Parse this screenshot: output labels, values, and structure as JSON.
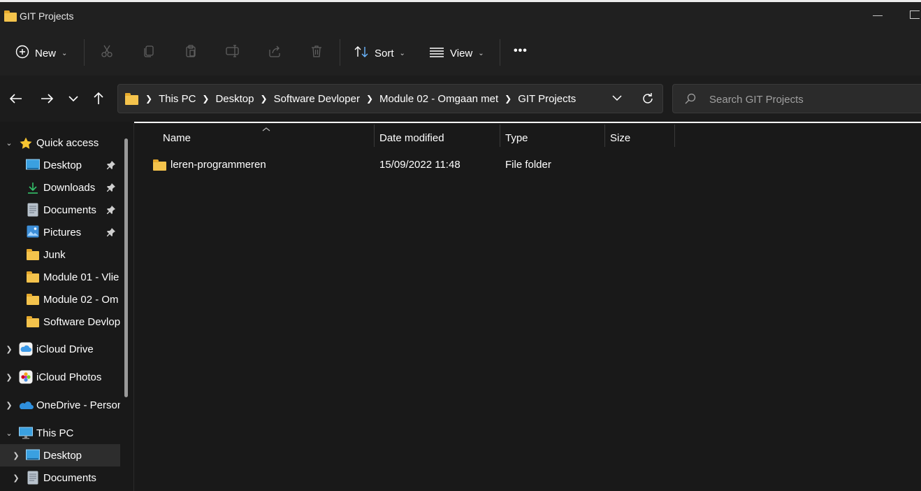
{
  "window": {
    "title": "GIT Projects"
  },
  "toolbar": {
    "new_label": "New",
    "sort_label": "Sort",
    "view_label": "View",
    "icons": [
      "cut-icon",
      "copy-icon",
      "paste-icon",
      "rename-icon",
      "share-icon",
      "delete-icon"
    ],
    "more_label": "•••"
  },
  "address": {
    "crumbs": [
      "This PC",
      "Desktop",
      "Software Devloper",
      "Module 02 - Omgaan met",
      "GIT Projects"
    ]
  },
  "search": {
    "placeholder": "Search GIT Projects"
  },
  "sidebar": {
    "quick_access": "Quick access",
    "items": [
      {
        "label": "Desktop",
        "icon": "desktop-icon",
        "pinned": true
      },
      {
        "label": "Downloads",
        "icon": "download-icon",
        "pinned": true
      },
      {
        "label": "Documents",
        "icon": "documents-icon",
        "pinned": true
      },
      {
        "label": "Pictures",
        "icon": "pictures-icon",
        "pinned": true
      },
      {
        "label": "Junk",
        "icon": "folder-icon",
        "pinned": false
      },
      {
        "label": "Module 01 - Vlie",
        "icon": "folder-icon",
        "pinned": false
      },
      {
        "label": "Module 02 - Om",
        "icon": "folder-icon",
        "pinned": false
      },
      {
        "label": "Software Devlop",
        "icon": "folder-icon",
        "pinned": false
      }
    ],
    "icloud_drive": "iCloud Drive",
    "icloud_photos": "iCloud Photos",
    "onedrive": "OneDrive - Person",
    "this_pc": "This PC",
    "pc_items": [
      {
        "label": "Desktop",
        "icon": "desktop-icon",
        "selected": true
      },
      {
        "label": "Documents",
        "icon": "documents-icon",
        "selected": false
      }
    ]
  },
  "columns": {
    "name": "Name",
    "date": "Date modified",
    "type": "Type",
    "size": "Size"
  },
  "files": [
    {
      "name": "leren-programmeren",
      "date": "15/09/2022 11:48",
      "type": "File folder",
      "size": ""
    }
  ],
  "colors": {
    "background": "#191919",
    "toolbar": "#202020",
    "folder": "#f4c34c",
    "selected": "#2d2d2d"
  }
}
